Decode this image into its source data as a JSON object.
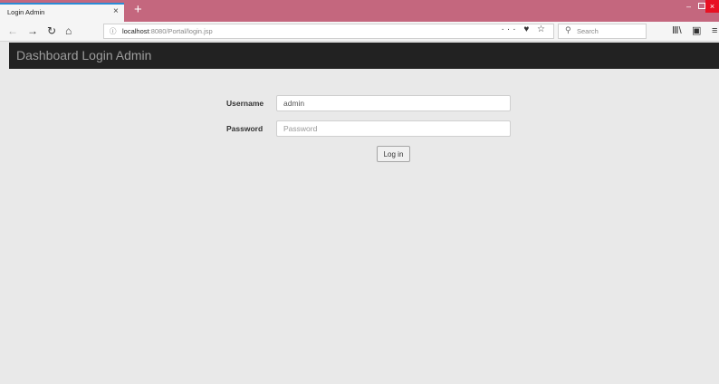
{
  "browser": {
    "tab_title": "Login Admin",
    "tab_close": "×",
    "new_tab": "+",
    "url_info_icon": "ⓘ",
    "url_host": "localhost",
    "url_rest": ":8080/Portal/login.jsp",
    "url_actions": "··· ♥ ☆",
    "search_icon": "⚲",
    "search_placeholder": "Search",
    "nav_icons": {
      "back": "←",
      "forward": "→",
      "reload": "↻",
      "home": "⌂"
    },
    "tool_icons": {
      "library": "Ⅲ\\",
      "sidebar": "▣",
      "menu": "≡"
    },
    "window_controls": {
      "minimize": "–",
      "close": "×"
    }
  },
  "header": {
    "brand": "Dashboard Login Admin"
  },
  "form": {
    "username_label": "Username",
    "username_value": "admin",
    "password_label": "Password",
    "password_placeholder": "Password",
    "submit_label": "Log in"
  },
  "colors": {
    "tabstrip": "#c4677e",
    "header_bg": "#222222",
    "page_bg": "#e9e9e9"
  }
}
